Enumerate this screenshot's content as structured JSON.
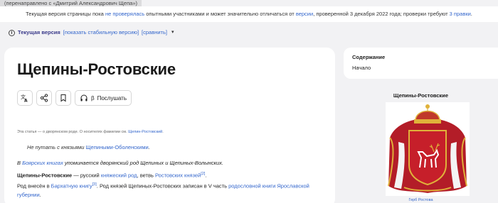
{
  "redirect": "(перенаправлено с «Дмитрий Александрович Щепа»)",
  "banner": {
    "t1": "Текущая версия страницы пока ",
    "l1": "не проверялась",
    "t2": " опытными участниками и может значительно отличаться от ",
    "l2": "версии",
    "t3": ", проверенной 3 декабря 2022 года; проверки требуют ",
    "l3": "3 правки",
    "t4": "."
  },
  "revision": {
    "current": "Текущая версия",
    "stable": "[показать стабильную версию]",
    "compare": "[сравнить]"
  },
  "title": "Щепины-Ростовские",
  "tools": {
    "listen": "Послушать",
    "beta": "β"
  },
  "hatnote1": {
    "text": "Эта статья — о дворянском роде. О носителях фамилии см. ",
    "link": "Щепин-Ростовский",
    "end": "."
  },
  "hatnote2": {
    "text": "Не путать с князьями ",
    "link": "Щепиными-Оболенскими",
    "end": "."
  },
  "p1": {
    "prefix": "В ",
    "link": "Боярских книгах",
    "rest": " упоминается дворянский род Щепиных и Щепиных-Волынских."
  },
  "p2": {
    "bold": "Щепины-Ростовские",
    "t1": " — русский ",
    "l1": "княжеский род",
    "t2": ", ветвь ",
    "l2": "Ростовских князей",
    "ref": "[2]",
    "t3": "."
  },
  "p3": {
    "t1": "Род внесён в ",
    "l1": "Бархатную книгу",
    "ref": "[3]",
    "t2": ". Род князей Щепиных-Ростовских записан в V часть ",
    "l2": "родословной книги Ярославской губернии",
    "t3": "."
  },
  "toc": {
    "title": "Содержание",
    "item": "Начало"
  },
  "infobox": {
    "title": "Щепины-Ростовские",
    "caption": "Герб Ростова"
  },
  "colors": {
    "link": "#3366cc",
    "crown": "#c0392b",
    "shield": "#c61f2a",
    "gold": "#e0b23a"
  }
}
